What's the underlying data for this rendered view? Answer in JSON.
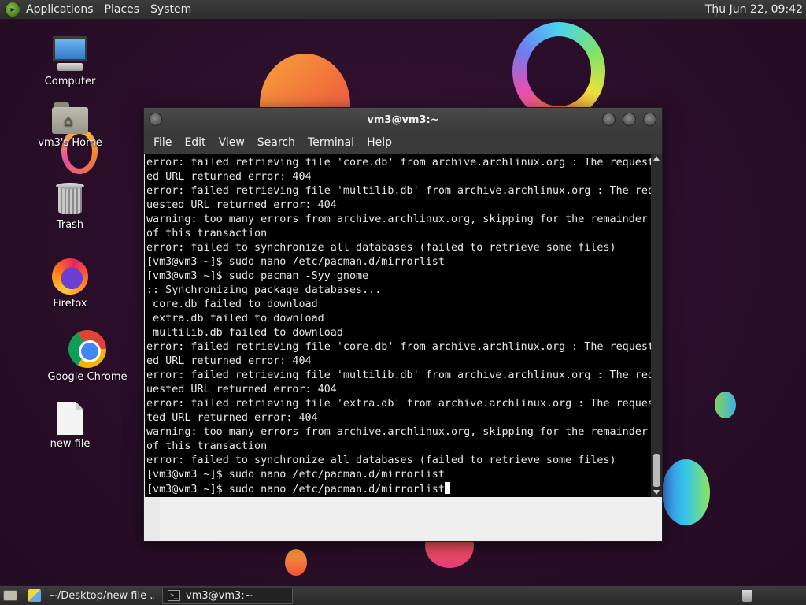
{
  "top_panel": {
    "menus": [
      "Applications",
      "Places",
      "System"
    ],
    "clock": "Thu Jun 22, 09:42"
  },
  "desktop": {
    "icons": [
      {
        "label": "Computer",
        "icon": "computer-icon"
      },
      {
        "label": "vm3's Home",
        "icon": "home-folder-icon"
      },
      {
        "label": "Trash",
        "icon": "trash-icon"
      },
      {
        "label": "Firefox",
        "icon": "firefox-icon"
      },
      {
        "label": "Google Chrome",
        "icon": "chrome-icon"
      },
      {
        "label": "new file",
        "icon": "file-icon"
      }
    ]
  },
  "terminal": {
    "title": "vm3@vm3:~",
    "menus": [
      "File",
      "Edit",
      "View",
      "Search",
      "Terminal",
      "Help"
    ],
    "lines": [
      "error: failed retrieving file 'core.db' from archive.archlinux.org : The request",
      "ed URL returned error: 404",
      "error: failed retrieving file 'multilib.db' from archive.archlinux.org : The req",
      "uested URL returned error: 404",
      "warning: too many errors from archive.archlinux.org, skipping for the remainder",
      "of this transaction",
      "error: failed to synchronize all databases (failed to retrieve some files)",
      "[vm3@vm3 ~]$ sudo nano /etc/pacman.d/mirrorlist",
      "[vm3@vm3 ~]$ sudo pacman -Syy gnome",
      ":: Synchronizing package databases...",
      " core.db failed to download",
      " extra.db failed to download",
      " multilib.db failed to download",
      "error: failed retrieving file 'core.db' from archive.archlinux.org : The request",
      "ed URL returned error: 404",
      "error: failed retrieving file 'multilib.db' from archive.archlinux.org : The req",
      "uested URL returned error: 404",
      "error: failed retrieving file 'extra.db' from archive.archlinux.org : The reques",
      "ted URL returned error: 404",
      "warning: too many errors from archive.archlinux.org, skipping for the remainder",
      "of this transaction",
      "error: failed to synchronize all databases (failed to retrieve some files)",
      "[vm3@vm3 ~]$ sudo nano /etc/pacman.d/mirrorlist"
    ],
    "prompt_line": "[vm3@vm3 ~]$ sudo nano /etc/pacman.d/mirrorlist"
  },
  "taskbar": {
    "tasks": [
      {
        "label": "~/Desktop/new file ...",
        "icon": "text-editor-icon",
        "active": false
      },
      {
        "label": "vm3@vm3:~",
        "icon": "terminal-icon",
        "active": true
      }
    ]
  },
  "colors": {
    "wallpaper": "#2a0e29",
    "panel": "#333333",
    "terminal_bg": "#000000",
    "terminal_fg": "#e8e8e8"
  }
}
